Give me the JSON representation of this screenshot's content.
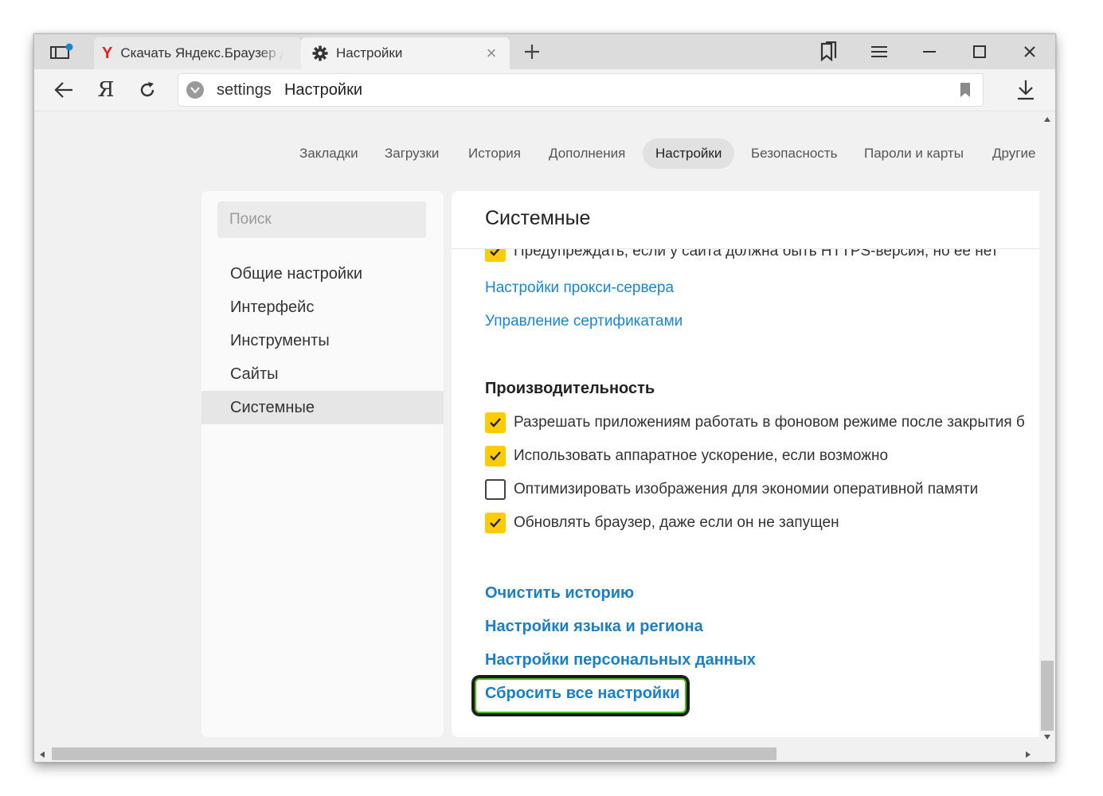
{
  "tabs": [
    {
      "title": "Скачать Яндекс.Браузер для",
      "icon": "yandex-y-icon",
      "active": false
    },
    {
      "title": "Настройки",
      "icon": "gear-icon",
      "active": true
    }
  ],
  "addressbar": {
    "protocol": "settings",
    "page_title": "Настройки"
  },
  "top_nav": [
    "Закладки",
    "Загрузки",
    "История",
    "Дополнения",
    "Настройки",
    "Безопасность",
    "Пароли и карты",
    "Другие"
  ],
  "top_nav_active": "Настройки",
  "sidebar": {
    "search_placeholder": "Поиск",
    "items": [
      "Общие настройки",
      "Интерфейс",
      "Инструменты",
      "Сайты",
      "Системные"
    ],
    "active": "Системные"
  },
  "main": {
    "title": "Системные",
    "https_warning": "Предупреждать, если у сайта должна быть HTTPS-версия, но её нет",
    "https_warning_checked": true,
    "links_network": [
      "Настройки прокси-сервера",
      "Управление сертификатами"
    ],
    "performance": {
      "title": "Производительность",
      "options": [
        {
          "label": "Разрешать приложениям работать в фоновом режиме после закрытия б",
          "checked": true
        },
        {
          "label": "Использовать аппаратное ускорение, если возможно",
          "checked": true
        },
        {
          "label": "Оптимизировать изображения для экономии оперативной памяти",
          "checked": false
        },
        {
          "label": "Обновлять браузер, даже если он не запущен",
          "checked": true
        }
      ]
    },
    "links_bottom": [
      "Очистить историю",
      "Настройки языка и региона",
      "Настройки персональных данных",
      "Сбросить все настройки"
    ],
    "highlighted_link": "Сбросить все настройки"
  },
  "colors": {
    "accent_link": "#1a86d0",
    "checkbox_checked": "#ffcc00",
    "highlight_border": "#4cbb17"
  }
}
